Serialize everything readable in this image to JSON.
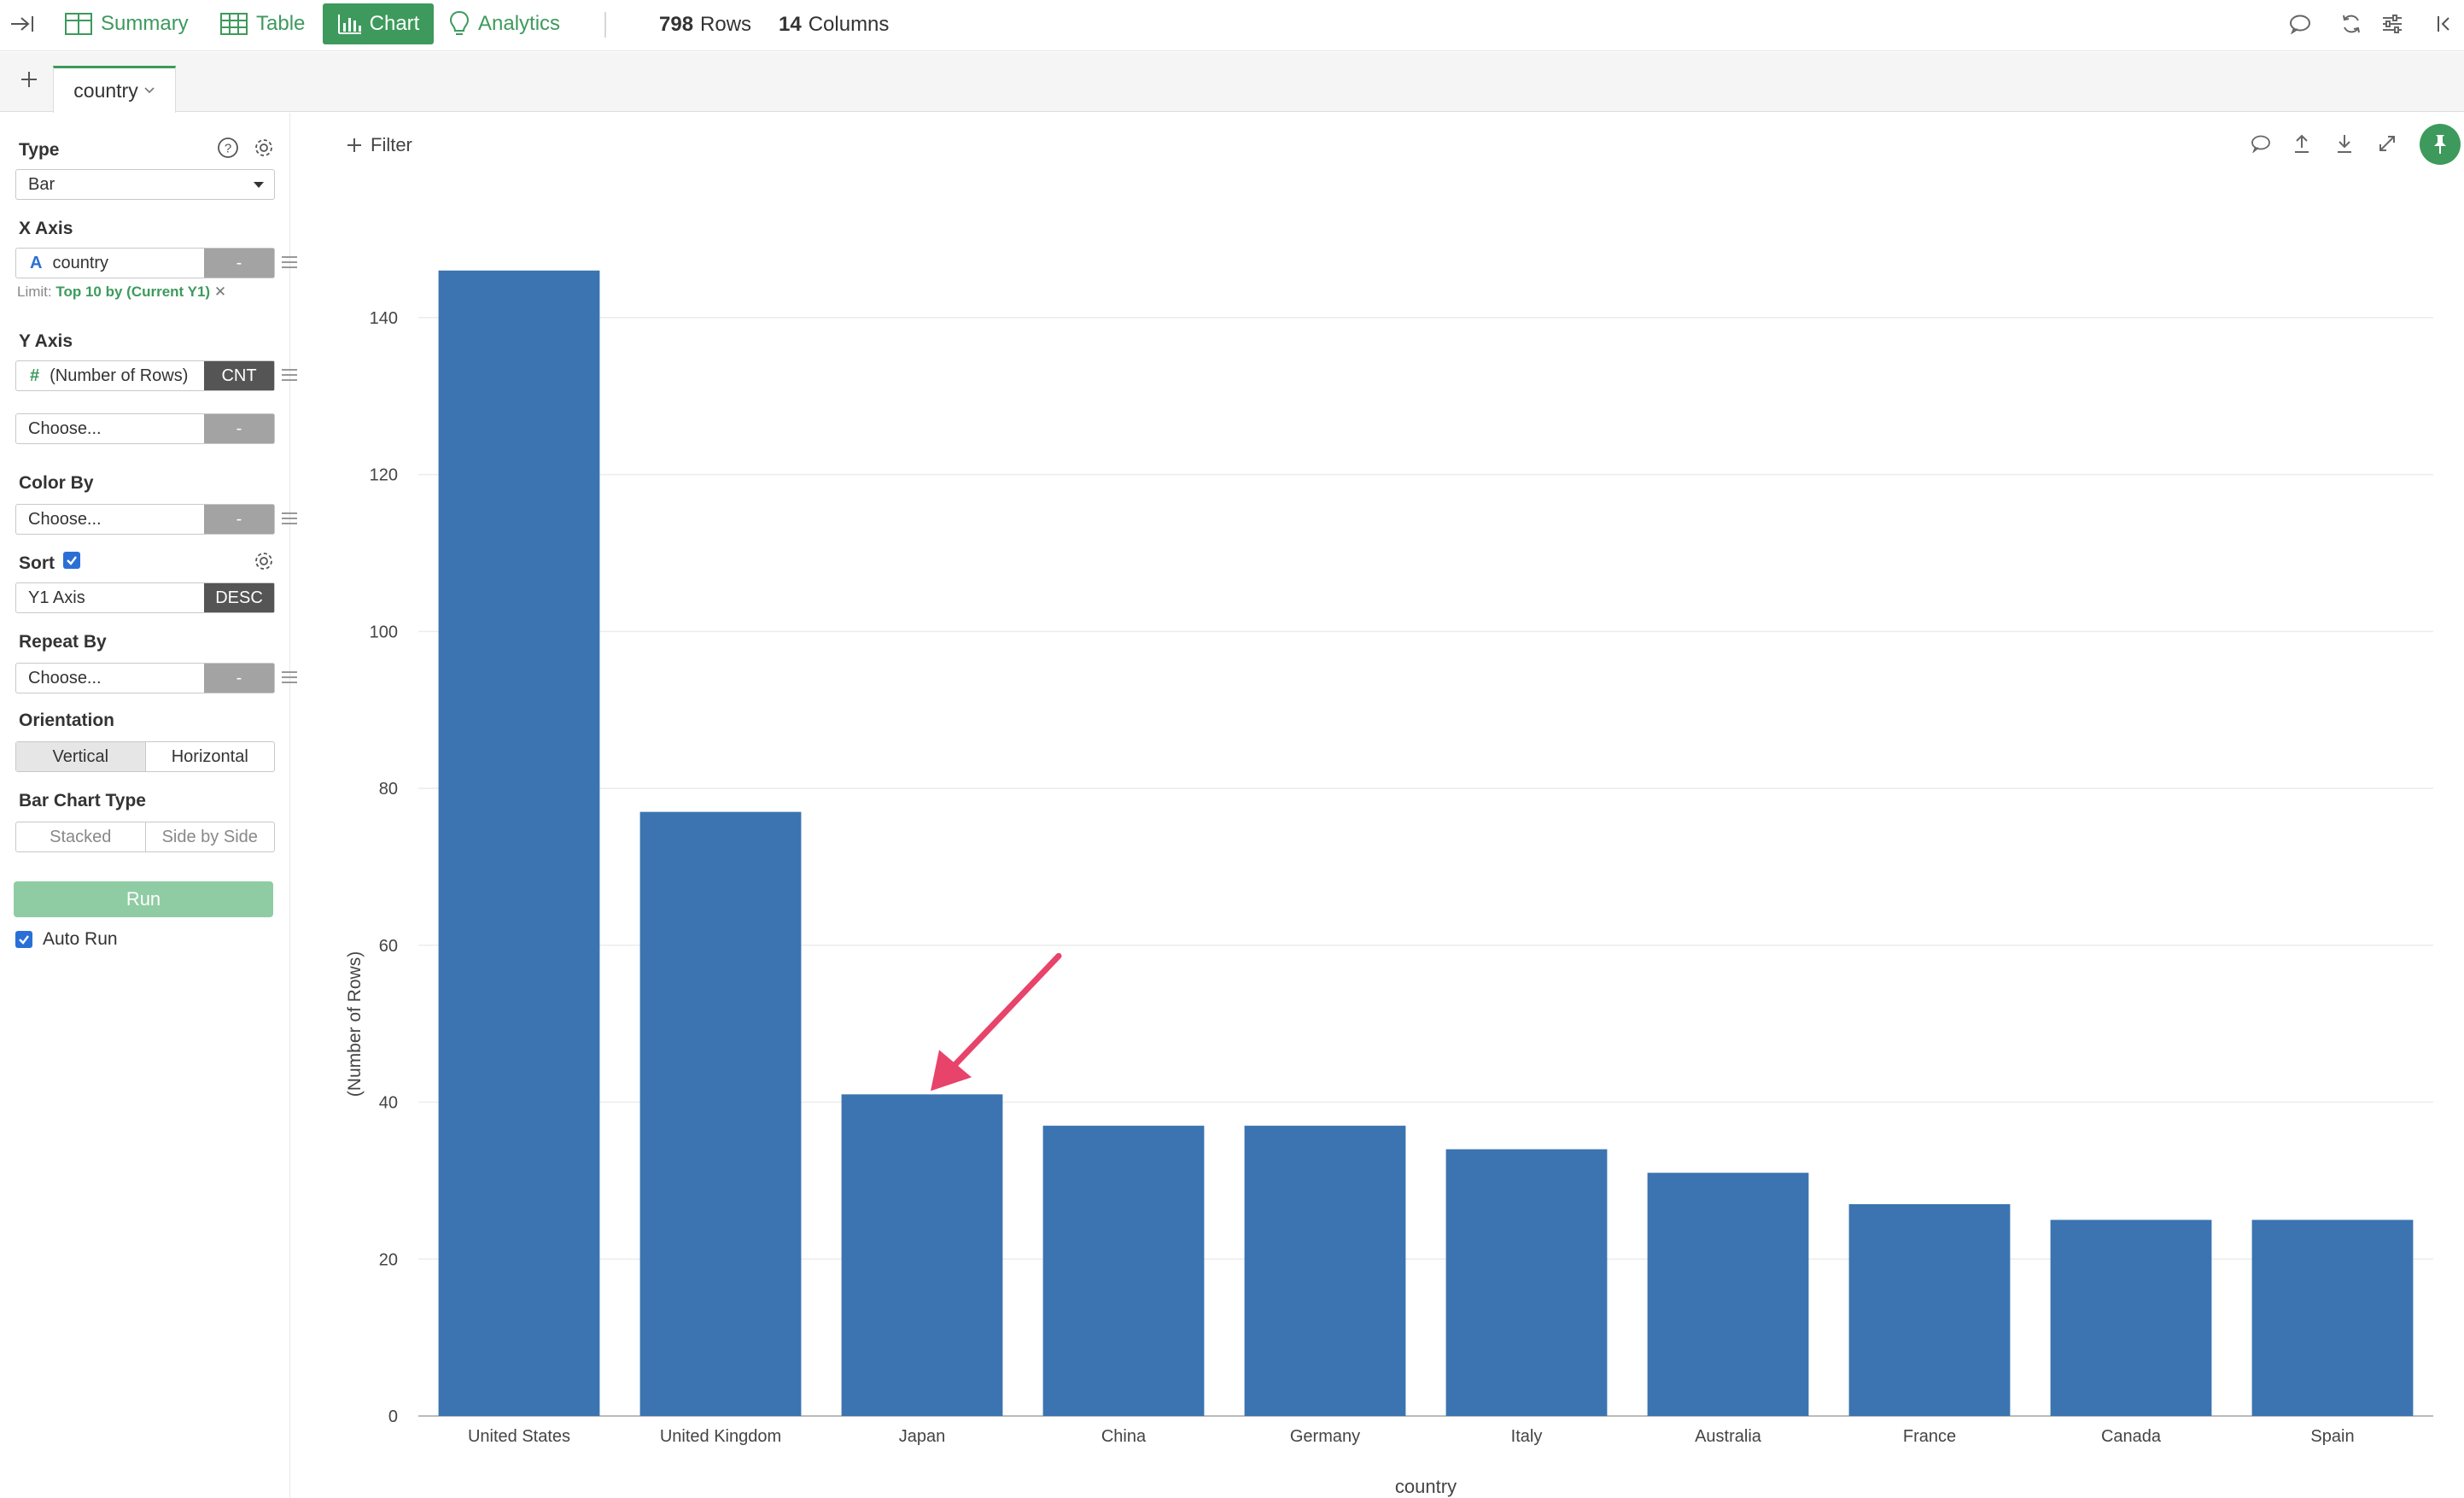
{
  "toolbar": {
    "summary_label": "Summary",
    "table_label": "Table",
    "chart_label": "Chart",
    "analytics_label": "Analytics",
    "rows_count": "798",
    "rows_label": "Rows",
    "columns_count": "14",
    "columns_label": "Columns",
    "accent_color": "#3d9a5c"
  },
  "tabs": [
    {
      "label": "country"
    }
  ],
  "panel": {
    "type_label": "Type",
    "type_value": "Bar",
    "x_axis_label": "X Axis",
    "x_axis_field": "country",
    "x_axis_agg": "-",
    "limit_prefix": "Limit:",
    "limit_value": "Top 10 by (Current Y1)",
    "y_axis_label": "Y Axis",
    "y_axis_field": "(Number of Rows)",
    "y_axis_agg": "CNT",
    "y2_placeholder": "Choose...",
    "y2_agg": "-",
    "color_by_label": "Color By",
    "color_by_placeholder": "Choose...",
    "color_by_agg": "-",
    "sort_label": "Sort",
    "sort_checked": true,
    "sort_field": "Y1 Axis",
    "sort_order": "DESC",
    "repeat_by_label": "Repeat By",
    "repeat_by_placeholder": "Choose...",
    "repeat_by_agg": "-",
    "orientation_label": "Orientation",
    "orientation_options": [
      "Vertical",
      "Horizontal"
    ],
    "orientation_selected": "Vertical",
    "bar_type_label": "Bar Chart Type",
    "bar_type_options": [
      "Stacked",
      "Side by Side"
    ],
    "run_label": "Run",
    "auto_run_label": "Auto Run",
    "auto_run_checked": true
  },
  "chart_toolbar": {
    "filter_label": "Filter"
  },
  "chart_data": {
    "type": "bar",
    "categories": [
      "United States",
      "United Kingdom",
      "Japan",
      "China",
      "Germany",
      "Italy",
      "Australia",
      "France",
      "Canada",
      "Spain"
    ],
    "values": [
      146,
      77,
      41,
      37,
      37,
      34,
      31,
      27,
      25,
      25
    ],
    "xlabel": "country",
    "ylabel": "(Number of Rows)",
    "ylim": [
      0,
      150
    ],
    "yticks": [
      0,
      20,
      40,
      60,
      80,
      100,
      120,
      140
    ],
    "grid": true,
    "bar_color": "#3b74b0",
    "annotation": {
      "type": "arrow",
      "target_category": "Japan",
      "color": "#e8436a"
    }
  }
}
